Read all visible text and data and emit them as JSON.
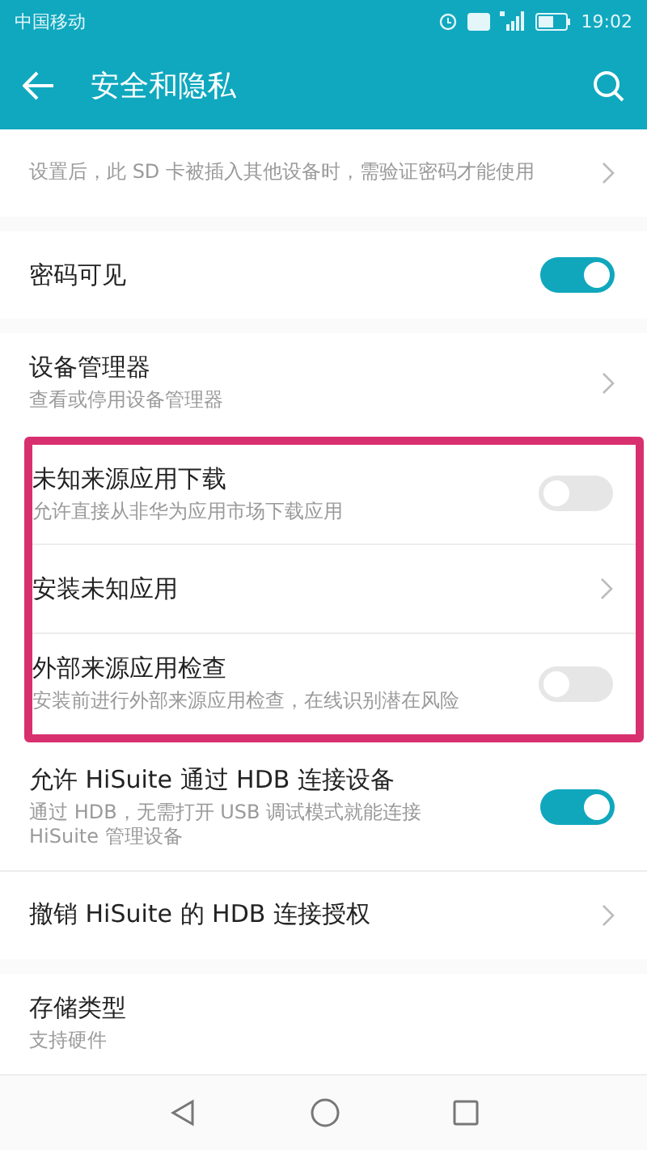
{
  "status_bar": {
    "carrier": "中国移动",
    "time": "19:02"
  },
  "app_bar": {
    "title": "安全和隐私"
  },
  "sections": [
    {
      "parts": [
        {
          "items": [
            {
              "kind": "link",
              "subtitle": "设置后，此 SD 卡被插入其他设备时，需验证密码才能使用"
            }
          ]
        }
      ]
    },
    {
      "parts": [
        {
          "items": [
            {
              "kind": "toggle",
              "title": "密码可见",
              "on": true
            }
          ]
        }
      ]
    },
    {
      "parts": [
        {
          "items": [
            {
              "kind": "link",
              "title": "设备管理器",
              "subtitle": "查看或停用设备管理器"
            }
          ]
        },
        {
          "highlighted": true,
          "items": [
            {
              "kind": "toggle",
              "title": "未知来源应用下载",
              "subtitle": "允许直接从非华为应用市场下载应用",
              "on": false
            },
            {
              "kind": "link",
              "title": "安装未知应用"
            },
            {
              "kind": "toggle",
              "title": "外部来源应用检查",
              "subtitle": "安装前进行外部来源应用检查，在线识别潜在风险",
              "on": false
            }
          ]
        },
        {
          "items": [
            {
              "kind": "toggle",
              "title": "允许 HiSuite 通过 HDB 连接设备",
              "subtitle": "通过 HDB，无需打开 USB 调试模式就能连接 HiSuite 管理设备",
              "on": true
            },
            {
              "kind": "link",
              "title": "撤销 HiSuite 的 HDB 连接授权"
            }
          ]
        }
      ]
    },
    {
      "parts": [
        {
          "items": [
            {
              "kind": "info",
              "title": "存储类型",
              "subtitle": "支持硬件"
            }
          ]
        }
      ]
    }
  ]
}
